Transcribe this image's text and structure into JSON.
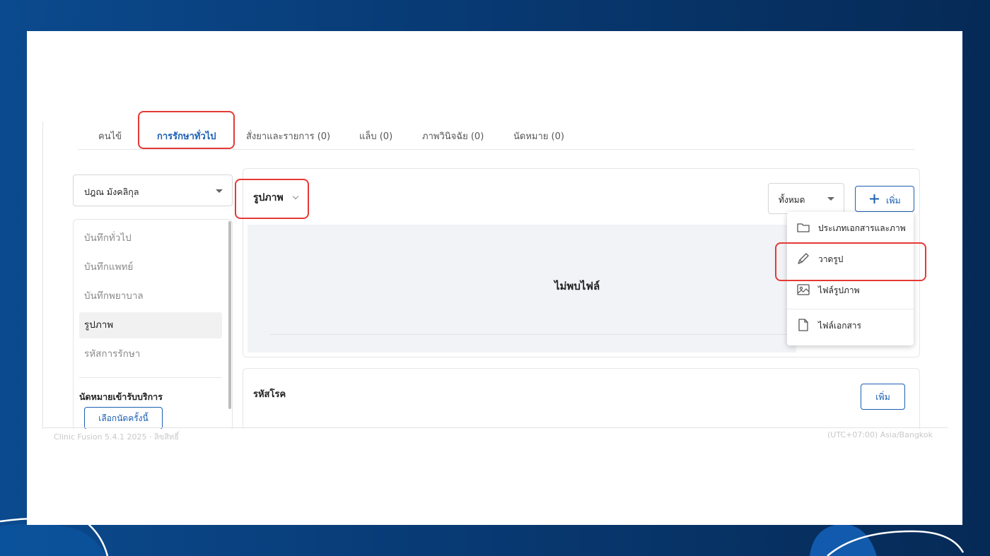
{
  "tabs": [
    {
      "label": "คนไข้"
    },
    {
      "label": "การรักษาทั่วไป",
      "active": true
    },
    {
      "label": "สั่งยาและรายการ (0)"
    },
    {
      "label": "แล็บ (0)"
    },
    {
      "label": "ภาพวินิจฉัย (0)"
    },
    {
      "label": "นัดหมาย (0)"
    }
  ],
  "doctor_select": {
    "value": "ปฎณ มังคลิกุล"
  },
  "record_list": {
    "items": [
      {
        "label": "บันทึกทั่วไป"
      },
      {
        "label": "บันทึกแพทย์"
      },
      {
        "label": "บันทึกพยาบาล"
      },
      {
        "label": "รูปภาพ",
        "selected": true
      },
      {
        "label": "รหัสการรักษา"
      }
    ],
    "appointment_title": "นัดหมายเข้ารับบริการ",
    "appointment_button": "เลือกนัดครั้งนี้"
  },
  "images_section": {
    "title": "รูปภาพ",
    "filter_value": "ทั้งหมด",
    "add_label": "เพิ่ม",
    "empty_text": "ไม่พบไฟล์"
  },
  "add_menu": {
    "items": [
      {
        "label": "ประเภทเอกสารและภาพ",
        "icon": "folder-icon"
      },
      {
        "label": "วาดรูป",
        "icon": "pen-icon"
      },
      {
        "label": "ไฟล์รูปภาพ",
        "icon": "image-icon"
      },
      {
        "label": "ไฟล์เอกสาร",
        "icon": "file-icon"
      }
    ]
  },
  "diagnosis_section": {
    "title": "รหัสโรค",
    "add_label": "เพิ่ม"
  },
  "footer": {
    "left": "Clinic Fusion 5.4.1 2025 · ลิขสิทธิ์",
    "right": "(UTC+07:00) Asia/Bangkok"
  },
  "colors": {
    "accent": "#1b5fb3",
    "highlight": "#e53935",
    "background_dark": "#062a56"
  }
}
